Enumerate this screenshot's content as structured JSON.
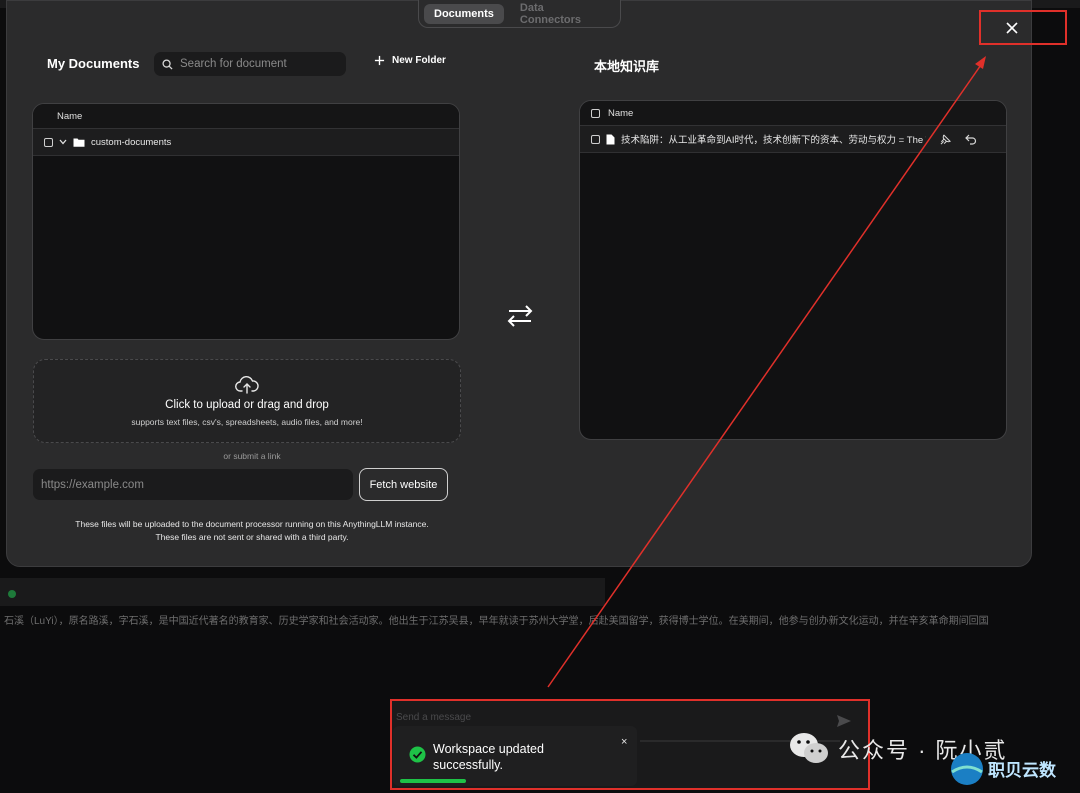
{
  "tabs": [
    {
      "label": "Documents",
      "active": true
    },
    {
      "label": "Data Connectors",
      "active": false
    }
  ],
  "my_documents": {
    "title": "My Documents",
    "search_placeholder": "Search for document",
    "new_folder_label": "New Folder",
    "table_header": "Name",
    "folders": [
      {
        "name": "custom-documents"
      }
    ]
  },
  "upload": {
    "title": "Click to upload or drag and drop",
    "subtitle": "supports text files, csv's, spreadsheets, audio files, and more!",
    "or_link": "or submit a link",
    "url_placeholder": "https://example.com",
    "fetch_label": "Fetch website",
    "notice_line1": "These files will be uploaded to the document processor running on this AnythingLLM instance.",
    "notice_line2": "These files are not sent or shared with a third party."
  },
  "workspace": {
    "title": "本地知识库",
    "table_header": "Name",
    "files": [
      {
        "name": "技术陷阱：从工业革命到AI时代，技术创新下的资本、劳动与权力 = The T..."
      }
    ]
  },
  "background": {
    "text": "石溪（LuYi），原名路溪，字石溪，是中国近代著名的教育家、历史学家和社会活动家。他出生于江苏吴县，早年就读于苏州大学堂，后赴美国留学，获得博士学位。在美期间，他参与创办新文化运动，并在辛亥革命期间回国"
  },
  "chat": {
    "placeholder": "Send a message"
  },
  "toast": {
    "message": "Workspace updated successfully.",
    "close_label": "×"
  },
  "watermark": {
    "text": "公众号 · 阮小贰",
    "brand": "职贝云数"
  },
  "colors": {
    "highlight": "#e0302a",
    "success": "#1ec247",
    "modal_bg": "#2b2b2c"
  }
}
